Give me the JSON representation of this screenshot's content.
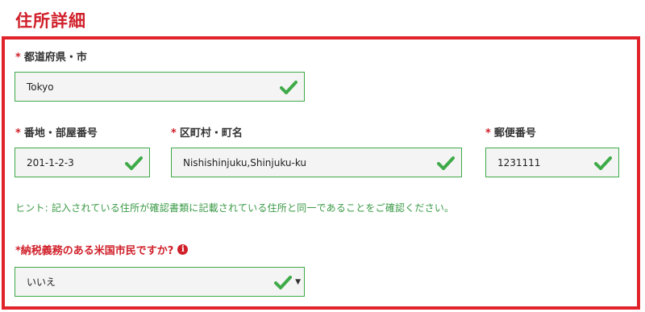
{
  "section": {
    "title": "住所詳細"
  },
  "required_mark": "*",
  "fields": {
    "prefecture_city": {
      "label": "都道府県・市",
      "value": "Tokyo"
    },
    "street_number": {
      "label": "番地・部屋番号",
      "value": "201-1-2-3"
    },
    "ward_town": {
      "label": "区町村・町名",
      "value": "Nishishinjuku,Shinjuku-ku"
    },
    "postal_code": {
      "label": "郵便番号",
      "value": "1231111"
    }
  },
  "hint": "ヒント: 記入されている住所が確認書類に記載されている住所と同一であることをご確認ください。",
  "us_tax": {
    "question": "*納税義務のある米国市民ですか?",
    "info_glyph": "i",
    "selected": "いいえ",
    "caret": "▼"
  },
  "colors": {
    "accent_red": "#e1232b",
    "valid_green": "#3eaa48",
    "hint_green": "#3a9a46"
  },
  "icons": {
    "valid": "check-icon",
    "info": "info-icon",
    "dropdown": "caret-down-icon"
  }
}
